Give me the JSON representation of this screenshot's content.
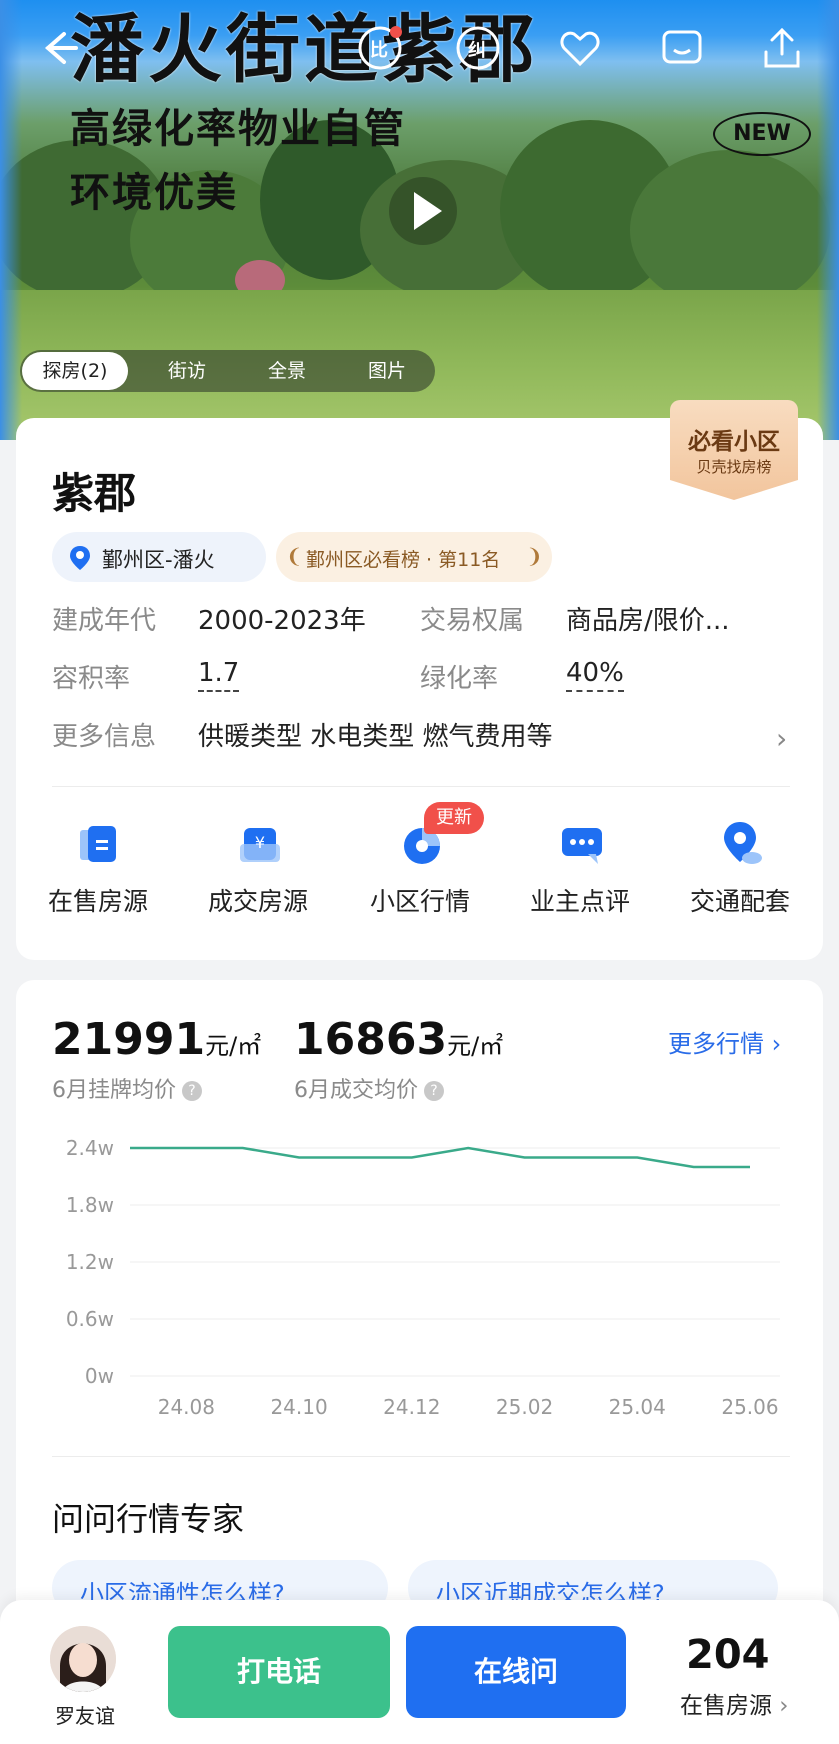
{
  "hero": {
    "title": "潘火街道紫郡",
    "subtitle1": "高绿化率物业自管",
    "subtitle2": "环境优美",
    "new_badge": "NEW",
    "media_tabs": [
      "探房(2)",
      "街访",
      "全景",
      "图片"
    ],
    "top_icons": [
      "back-arrow-icon",
      "compare-icon",
      "correct-icon",
      "favorite-heart-icon",
      "message-icon",
      "share-icon"
    ],
    "top_labels": {
      "compare": "比",
      "correct": "纠"
    }
  },
  "community": {
    "must_see_title": "必看小区",
    "must_see_sub": "贝壳找房榜",
    "name": "紫郡",
    "location": "鄞州区-潘火",
    "rank": "鄞州区必看榜 · 第11名",
    "attrs": {
      "built_label": "建成年代",
      "built_value": "2000-2023年",
      "rights_label": "交易权属",
      "rights_value": "商品房/限价...",
      "far_label": "容积率",
      "far_value": "1.7",
      "green_label": "绿化率",
      "green_value": "40%",
      "more_label": "更多信息",
      "more_value": "供暖类型 水电类型 燃气费用等"
    },
    "quick_links": [
      "在售房源",
      "成交房源",
      "小区行情",
      "业主点评",
      "交通配套"
    ],
    "update_badge": "更新"
  },
  "market": {
    "listing_price": "21991",
    "deal_price": "16863",
    "unit": "元/㎡",
    "listing_label": "6月挂牌均价",
    "deal_label": "6月成交均价",
    "more_link": "更多行情",
    "expert_title": "问问行情专家",
    "questions": [
      "小区流通性怎么样?",
      "小区近期成交怎么样?"
    ]
  },
  "chart_data": {
    "type": "line",
    "x": [
      "24.07",
      "24.08",
      "24.09",
      "24.10",
      "24.11",
      "24.12",
      "25.01",
      "25.02",
      "25.03",
      "25.04",
      "25.05",
      "25.06"
    ],
    "tick_labels": [
      "24.08",
      "24.10",
      "24.12",
      "25.02",
      "25.04",
      "25.06"
    ],
    "y_ticks": [
      "2.4w",
      "1.8w",
      "1.2w",
      "0.6w",
      "0w"
    ],
    "series": [
      {
        "values": [
          2.4,
          2.4,
          2.4,
          2.3,
          2.3,
          2.3,
          2.4,
          2.3,
          2.3,
          2.3,
          2.2,
          2.2
        ],
        "color": "#3aaa8a"
      }
    ],
    "ylim": [
      0,
      2.4
    ],
    "grid": true
  },
  "bottom": {
    "agent_name": "罗友谊",
    "call_label": "打电话",
    "online_label": "在线问",
    "onsale_count": "204",
    "onsale_label": "在售房源"
  },
  "colors": {
    "accent": "#1f6ff1",
    "call": "#3cc18c",
    "link": "#2a6ce8",
    "badge": "#f1504a"
  }
}
